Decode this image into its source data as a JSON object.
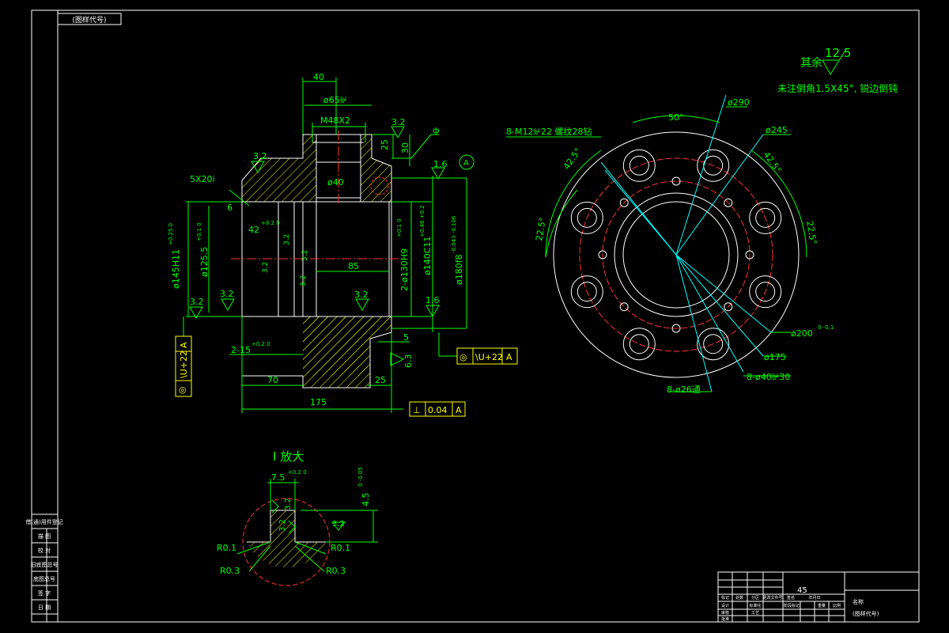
{
  "colors": {
    "background": "#000000",
    "border": "#ffffff",
    "dim": "#00ff00",
    "part": "#ffffff",
    "hatch": "#ffff00",
    "center": "#ff3333",
    "leader": "#00ffff",
    "label": "#ffff00"
  },
  "frame": {
    "code_box": "(图样代号)"
  },
  "notes": {
    "qiyu": "其余",
    "qiyu_rough": "12.5",
    "chamfer_note": "未注倒角1.5X45°, 锐边倒钝"
  },
  "section": {
    "dims": {
      "d40_top": "40",
      "d65": "ø65⊮",
      "m48": "M48X2",
      "d25": "25",
      "d30": "30",
      "d32_top": "3.2",
      "d32_left": "3.2",
      "chamfer": "5X20i",
      "d6": "6",
      "d40_bore": "ø40",
      "d16_top": "1.6",
      "datum_a": "A",
      "d42": "42",
      "d42_tol": "+0.2 0",
      "d145": "ø145H11",
      "d145_tol": "+0.25 0",
      "d125": "ø125.5",
      "d125_tol": "+0.1 0",
      "d32_a": "3.2",
      "d32_b": "3.2",
      "d32_c": "3.2",
      "d32_d": "3.2",
      "d85": "85",
      "d130": "2-ø130H9",
      "d130_tol": "+0.1 0",
      "d140": "ø140C11",
      "d140_tol": "+0.46 +0.2",
      "d180": "ø180f8",
      "d180_tol": "-0.043 -0.106",
      "d32_e": "3.2",
      "d32_f": "3.2",
      "d32_g": "3.2",
      "d16_b": "1.6",
      "d15": "2-15",
      "d15_tol": "+0.2 0",
      "d5": "5",
      "d63": "6.3",
      "d70": "70",
      "d25b": "25",
      "d175": "175",
      "face_sym": "ф",
      "gtol_right_sym": "◎",
      "gtol_right_val": "\\U+22",
      "gtol_right_datum": "A",
      "gtol_left_val": "\\U+22",
      "gtol_left_datum": "A",
      "gtol_left_sym": "◎",
      "gtol_bot_sym": "⊥",
      "gtol_bot_val": "0.04",
      "gtol_bot_datum": "A"
    }
  },
  "plan": {
    "dims": {
      "a50": "50°",
      "d290": "ø290",
      "m12": "8-M12⊮22  螺纹28钻",
      "d245": "ø245",
      "a425a": "42.5°",
      "a425b": "42.5°",
      "a225a": "22.5°",
      "a225b": "22.5°",
      "d200": "ø200",
      "d200_tol": "0 -0.1",
      "d175": "ø175",
      "d40x": "8-ø40⊮30",
      "d26": "8-ø26通"
    }
  },
  "detail": {
    "title": "I 放大",
    "dims": {
      "d75": "7.5",
      "d75_tol": "+0.2 0",
      "d45": "4.5",
      "d45_tol": "0 -0.05",
      "d32a": "3.2",
      "d32b": "3.2",
      "d32c": "3.2",
      "r01a": "R0.1",
      "r01b": "R0.1",
      "r03a": "R0.3",
      "r03b": "R0.3"
    }
  },
  "side_table": {
    "rows": [
      "借(通)用件登记",
      "描  图",
      "校  对",
      "旧底图总号",
      "底图总号",
      "签  字",
      "日  期"
    ]
  },
  "title_block": {
    "material": "45",
    "name_cell": "名称",
    "code_cell": "(图样代号)",
    "row_a": [
      "标记",
      "处数",
      "分区",
      "更改文件号",
      "签名",
      "年月日"
    ],
    "row_b": [
      "设计",
      "标准化",
      "阶段标记",
      "重量",
      "比例"
    ],
    "row_c": [
      "审核",
      "工艺",
      "批准"
    ]
  }
}
